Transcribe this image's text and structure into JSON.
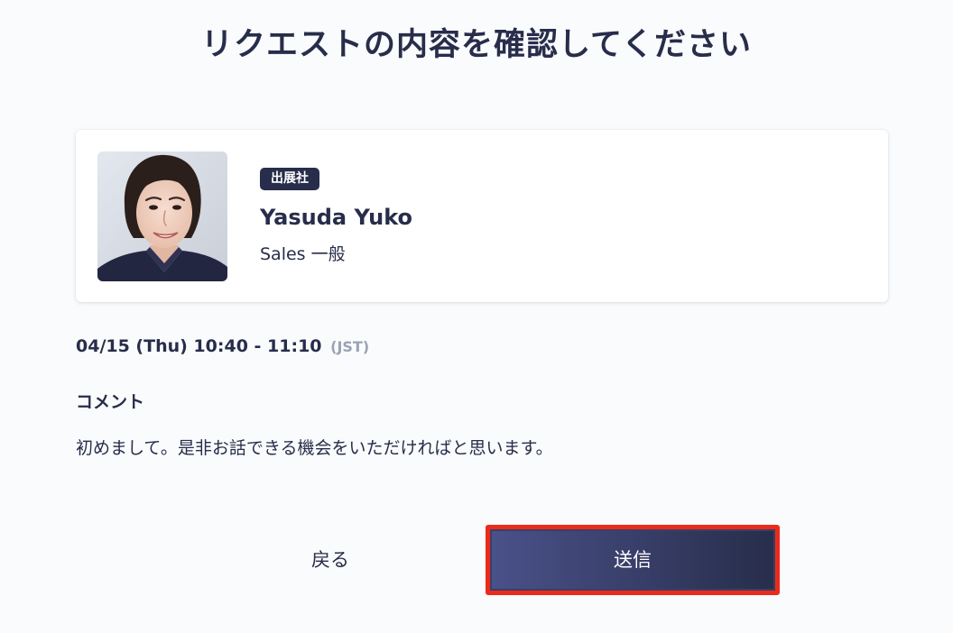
{
  "page": {
    "title": "リクエストの内容を確認してください"
  },
  "profile": {
    "badge": "出展社",
    "name": "Yasuda Yuko",
    "role": "Sales 一般",
    "avatar_description": "portrait-photo"
  },
  "schedule": {
    "datetime": "04/15 (Thu) 10:40 - 11:10",
    "timezone": "(JST)"
  },
  "comment": {
    "label": "コメント",
    "text": "初めまして。是非お話できる機会をいただければと思います。"
  },
  "actions": {
    "back_label": "戻る",
    "send_label": "送信"
  },
  "colors": {
    "text_primary": "#272d4a",
    "timezone_muted": "#9aa3b5",
    "badge_bg": "#272d4a",
    "send_gradient_start": "#4a5189",
    "send_gradient_end": "#272d4a",
    "highlight_border": "#ec2a1c"
  }
}
